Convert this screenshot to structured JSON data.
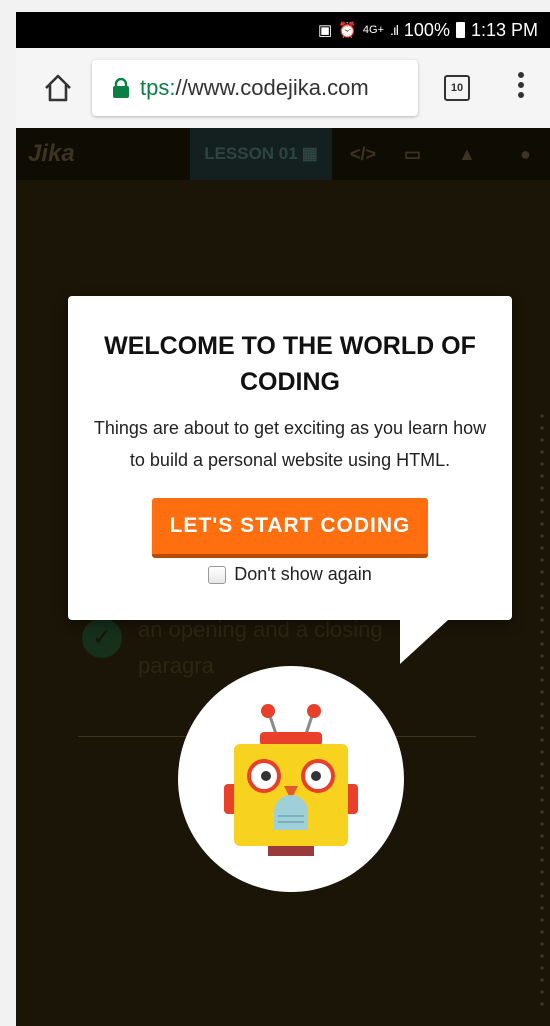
{
  "status_bar": {
    "signal": "4G+",
    "battery": "100%",
    "time": "1:13 PM"
  },
  "browser": {
    "url_scheme": "tps:",
    "url_rest": "//www.codejika.com",
    "tab_count": "10"
  },
  "site_nav": {
    "logo": "Jika",
    "lesson_tab": "LESSON 01"
  },
  "background_lesson": {
    "text": "an opening and a closing paragra"
  },
  "modal": {
    "title": "WELCOME TO THE WORLD OF CODING",
    "body": "Things are about to get exciting as you learn how to build a personal website using HTML.",
    "cta_label": "LET'S START CODING",
    "checkbox_label": "Don't show again"
  },
  "colors": {
    "cta": "#ff6f0f",
    "background": "#1b1507",
    "secure": "#0b8043"
  }
}
